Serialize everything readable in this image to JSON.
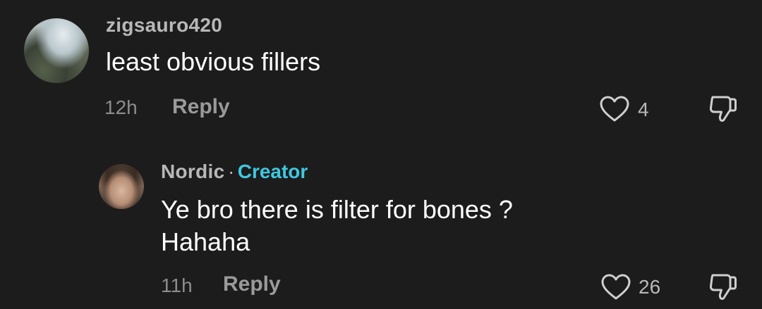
{
  "comments": [
    {
      "username": "zigsauro420",
      "text": "least obvious fillers",
      "time": "12h",
      "reply_label": "Reply",
      "like_count": "4"
    }
  ],
  "replies": [
    {
      "username": "Nordic",
      "separator": "·",
      "badge": "Creator",
      "text_line1": "Ye bro there is filter for bones ?",
      "text_line2": "Hahaha",
      "time": "11h",
      "reply_label": "Reply",
      "like_count": "26"
    }
  ],
  "colors": {
    "background": "#1c1c1c",
    "creator_badge": "#3ec8e0"
  },
  "icons": [
    "heart-outline-icon",
    "thumbs-down-outline-icon"
  ]
}
